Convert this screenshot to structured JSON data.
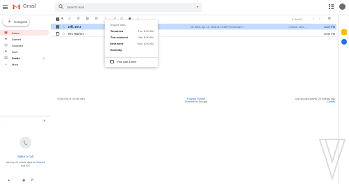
{
  "app": {
    "name": "Gmail"
  },
  "search": {
    "placeholder": "Search mail"
  },
  "compose": {
    "label": "Compose",
    "icon": "plus-icon"
  },
  "sidebar": {
    "items": [
      {
        "label": "Inbox",
        "icon": "inbox-icon",
        "active": true,
        "count": ""
      },
      {
        "label": "Starred",
        "icon": "star-icon",
        "active": false,
        "count": ""
      },
      {
        "label": "Snoozed",
        "icon": "clock-icon",
        "active": false,
        "count": ""
      },
      {
        "label": "Sent",
        "icon": "send-icon",
        "active": false,
        "count": ""
      },
      {
        "label": "Drafts",
        "icon": "draft-icon",
        "active": false,
        "count": "1"
      },
      {
        "label": "More",
        "icon": "chevron-down-icon",
        "active": false,
        "count": ""
      }
    ],
    "hangouts_user": "-",
    "call": {
      "title": "Make a call",
      "desc": "Also try our mobile apps for",
      "android": "Android",
      "and": " and ",
      "ios": "iOS"
    }
  },
  "toolbar": {
    "pager": "1–2 of 2"
  },
  "emails": [
    {
      "sender": "Jeff, me 2",
      "subject": "On Wed, Apr 11, 2018 at 10:56 PM Michael <",
      "snippet": "> wrote: Let's ...",
      "time": "11:07 PM",
      "selected": true,
      "unread": true
    },
    {
      "sender": "Tom Warren",
      "subject": "",
      "snippet": "",
      "time": "10:59 PM",
      "selected": false,
      "unread": false
    }
  ],
  "snooze_menu": {
    "title": "Snooze until...",
    "options": [
      {
        "label": "Tomorrow",
        "time": "Thu, 8:00 AM"
      },
      {
        "label": "This weekend",
        "time": "Sat, 8:00 AM"
      },
      {
        "label": "Next week",
        "time": "Mon, 8:00 AM"
      },
      {
        "label": "Someday",
        "time": ""
      }
    ],
    "pick": "Pick date & time"
  },
  "footer": {
    "storage": "0 GB (0%) of 15 GB used",
    "policies": "Program Policies",
    "powered": "Powered by",
    "google": "Google",
    "activity": "Last account activity: 26 minutes ago",
    "details": "Details"
  },
  "colors": {
    "accent": "#d93025",
    "selected_row": "#c2dbff",
    "link": "#1a73e8"
  }
}
